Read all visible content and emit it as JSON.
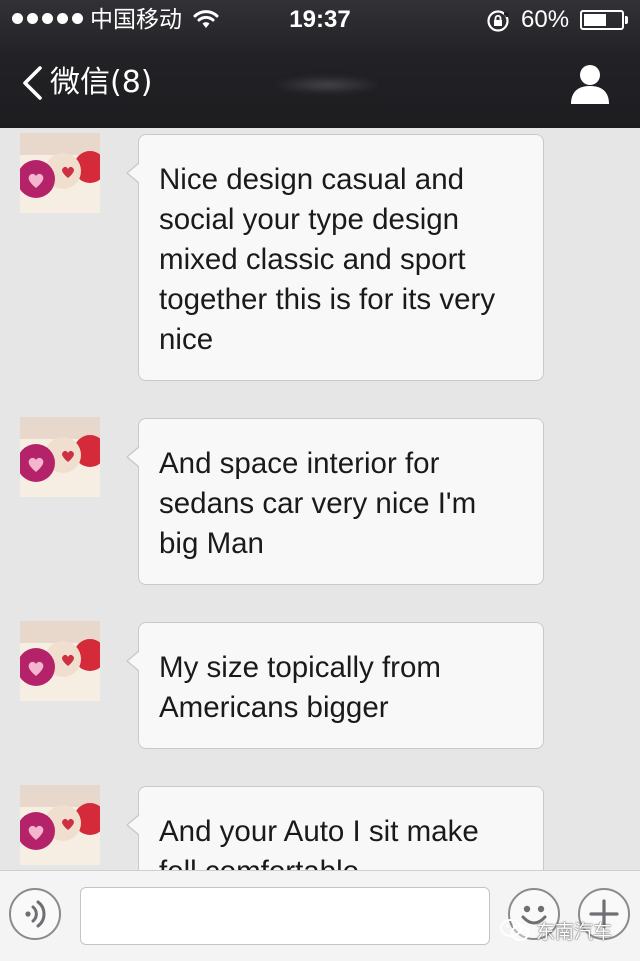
{
  "status_bar": {
    "carrier": "中国移动",
    "time": "19:37",
    "battery_percent": "60%",
    "battery_level": 0.6,
    "icons": [
      "signal-dots-icon",
      "wifi-icon",
      "rotation-lock-icon",
      "battery-icon"
    ]
  },
  "nav": {
    "back_label": "微信(8)",
    "back_icon": "chevron-left-icon",
    "profile_icon": "person-icon"
  },
  "messages": [
    {
      "text": "Nice design casual and social your type design mixed classic and sport together this is for its very nice"
    },
    {
      "text": "And space interior for sedans car very nice I'm big Man"
    },
    {
      "text": "My size topically from Americans bigger"
    },
    {
      "text": "And your Auto I sit make fell  comfortable"
    }
  ],
  "input_bar": {
    "voice_icon": "voice-icon",
    "emoji_icon": "emoji-icon",
    "more_icon": "plus-icon",
    "placeholder": ""
  },
  "watermark": {
    "text": "东南汽车",
    "icon": "wechat-logo-icon"
  },
  "colors": {
    "nav_background": "#222226",
    "chat_background": "#e6e6e6",
    "bubble_background": "#f8f8f8"
  }
}
